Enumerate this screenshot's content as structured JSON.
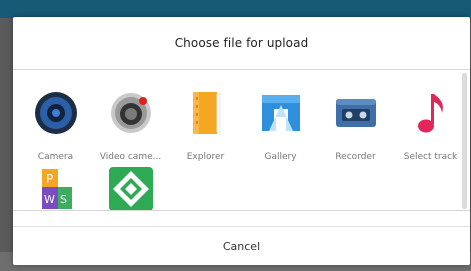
{
  "dialog": {
    "title": "Choose file for upload",
    "cancel_label": "Cancel"
  },
  "apps": [
    {
      "label": "Camera",
      "icon": "camera-icon"
    },
    {
      "label": "Video came...",
      "icon": "video-camera-icon"
    },
    {
      "label": "Explorer",
      "icon": "file-explorer-icon"
    },
    {
      "label": "Gallery",
      "icon": "gallery-icon"
    },
    {
      "label": "Recorder",
      "icon": "recorder-icon"
    },
    {
      "label": "Select track",
      "icon": "music-note-icon"
    },
    {
      "label": "",
      "icon": "office-suite-icon"
    },
    {
      "label": "",
      "icon": "green-diamond-app-icon"
    }
  ],
  "colors": {
    "top_bar": "#175a78",
    "music_accent": "#e0265a",
    "explorer_orange": "#f5a623",
    "gallery_blue": "#2f8fdc"
  }
}
